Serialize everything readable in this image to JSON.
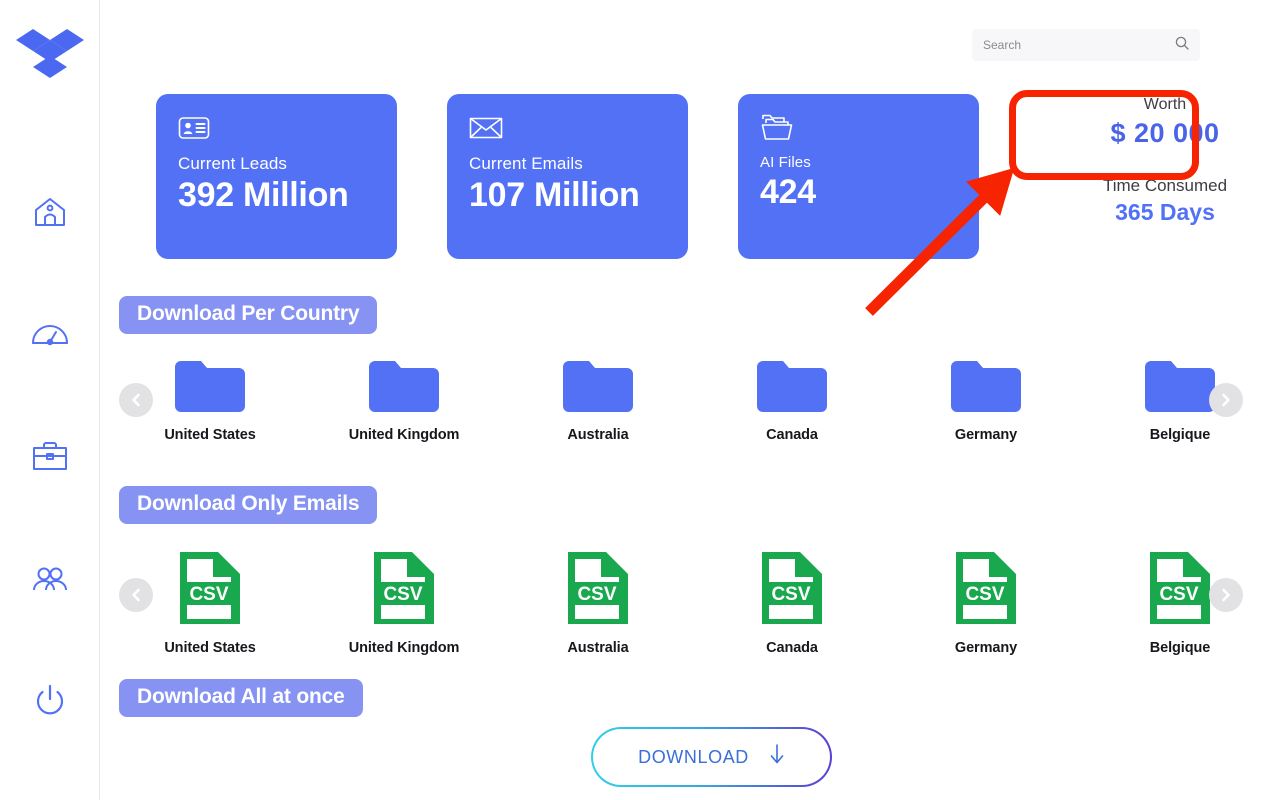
{
  "sidebar": {
    "brand_icon": "dropbox-logo",
    "items": [
      {
        "icon": "home-icon",
        "name": "home"
      },
      {
        "icon": "gauge-icon",
        "name": "dashboard"
      },
      {
        "icon": "briefcase-icon",
        "name": "business"
      },
      {
        "icon": "users-icon",
        "name": "contacts"
      },
      {
        "icon": "power-icon",
        "name": "logout"
      }
    ]
  },
  "search": {
    "placeholder": "Search",
    "value": "",
    "icon": "search-icon"
  },
  "stats": {
    "cards": [
      {
        "label": "Current Leads",
        "value": "392 Million",
        "icon": "id-card-icon"
      },
      {
        "label": "Current Emails",
        "value": "107 Million",
        "icon": "envelope-icon"
      },
      {
        "label": "AI Files",
        "value": "424",
        "icon": "folder-icon"
      }
    ],
    "worth": {
      "label": "Worth",
      "value": "$ 20 000"
    },
    "time": {
      "label": "Time Consumed",
      "value": "365 Days"
    }
  },
  "annotation": {
    "highlight_color": "#f62400",
    "arrow_color": "#f62400",
    "target": "worth-value"
  },
  "sections": {
    "per_country": {
      "title": "Download Per Country",
      "items": [
        {
          "label": "United States",
          "icon": "folder-icon"
        },
        {
          "label": "United Kingdom",
          "icon": "folder-icon"
        },
        {
          "label": "Australia",
          "icon": "folder-icon"
        },
        {
          "label": "Canada",
          "icon": "folder-icon"
        },
        {
          "label": "Germany",
          "icon": "folder-icon"
        },
        {
          "label": "Belgique",
          "icon": "folder-icon"
        }
      ]
    },
    "only_emails": {
      "title": "Download Only Emails",
      "items": [
        {
          "label": "United States",
          "icon": "csv-file-icon",
          "type": "CSV"
        },
        {
          "label": "United Kingdom",
          "icon": "csv-file-icon",
          "type": "CSV"
        },
        {
          "label": "Australia",
          "icon": "csv-file-icon",
          "type": "CSV"
        },
        {
          "label": "Canada",
          "icon": "csv-file-icon",
          "type": "CSV"
        },
        {
          "label": "Germany",
          "icon": "csv-file-icon",
          "type": "CSV"
        },
        {
          "label": "Belgique",
          "icon": "csv-file-icon",
          "type": "CSV"
        }
      ]
    },
    "all_at_once": {
      "title": "Download All at once",
      "button_label": "DOWNLOAD",
      "button_icon": "arrow-down-icon"
    }
  },
  "colors": {
    "accent_blue": "#5271f5",
    "pill_purple": "#8793f2",
    "csv_green": "#1aa84f",
    "annotation_red": "#f62400"
  }
}
